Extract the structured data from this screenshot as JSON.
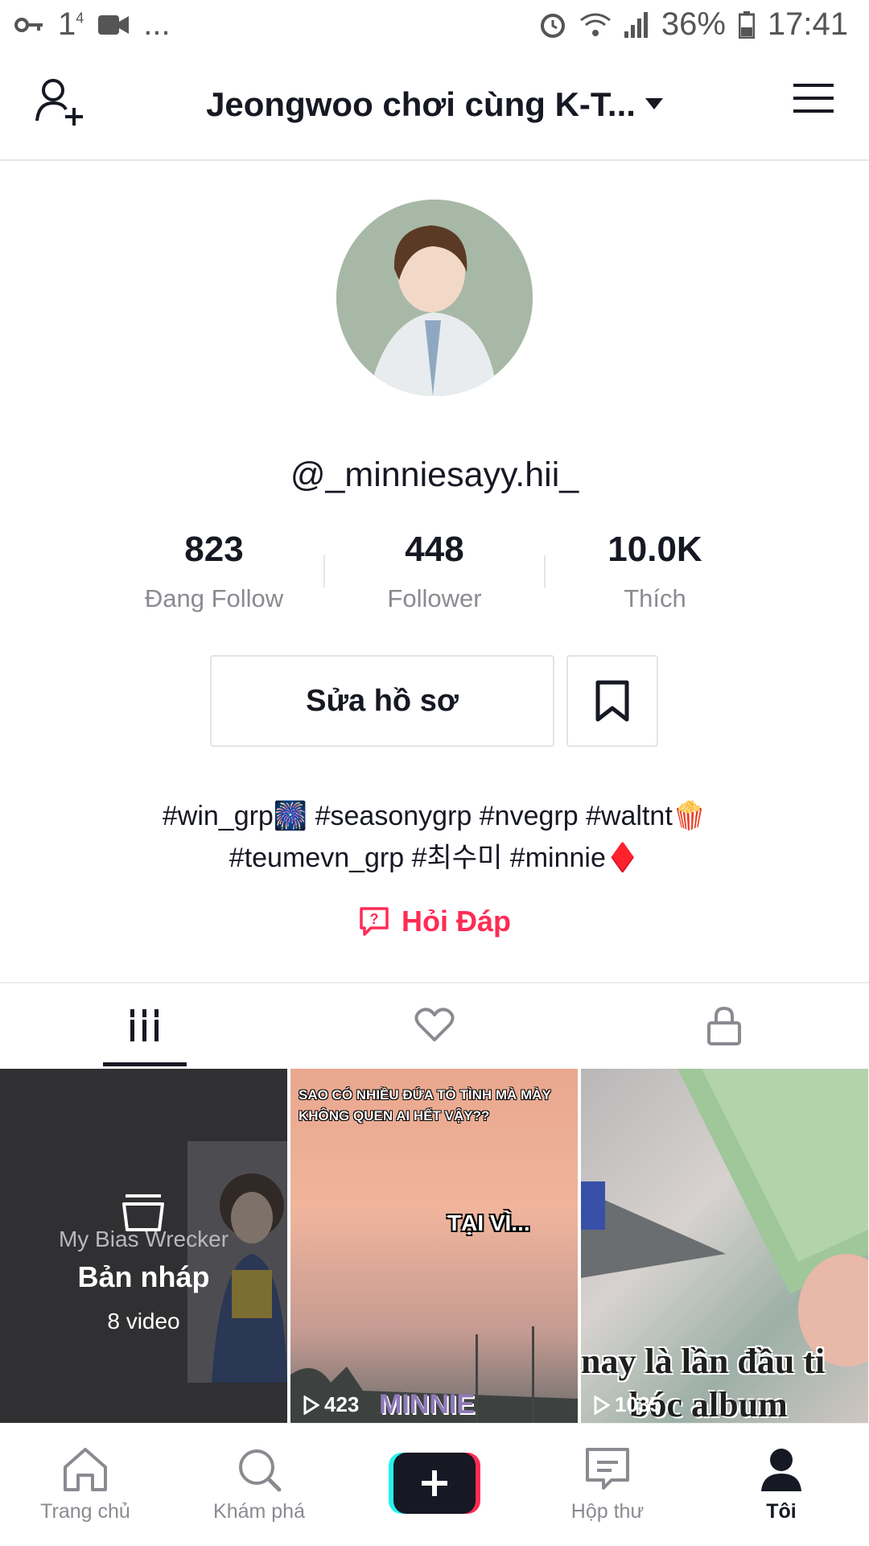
{
  "status_bar": {
    "left_text": "1",
    "left_superscript": "4",
    "more": "...",
    "battery": "36%",
    "time": "17:41"
  },
  "header": {
    "title": "Jeongwoo chơi cùng K-T..."
  },
  "profile": {
    "username": "@_minniesayy.hii_",
    "stats": [
      {
        "value": "823",
        "label": "Đang Follow"
      },
      {
        "value": "448",
        "label": "Follower"
      },
      {
        "value": "10.0K",
        "label": "Thích"
      }
    ],
    "edit_label": "Sửa hồ sơ",
    "bio_line1": "#win_grp🎆 #seasonygrp #nvegrp #waltnt🍿",
    "bio_line2": "#teumevn_grp #최수미 #minnie♦️",
    "qa_label": "Hỏi Đáp"
  },
  "grid": {
    "drafts_watermark": "My Bias Wrecker",
    "drafts_label": "Bản nháp",
    "drafts_count": "8 video",
    "video1_caption_top": "SAO CÓ NHIỀU ĐỨA TỎ TÌNH MÀ MÀY KHÔNG QUEN AI HẾT VẬY??",
    "video1_caption_mid": "TẠI VÌ...",
    "video1_views": "423",
    "video1_bottom": "MINNIE",
    "video2_caption": "nay là lần đầu ti",
    "video2_caption2": "bóc album",
    "video2_views": "1035"
  },
  "nav": {
    "home": "Trang chủ",
    "discover": "Khám phá",
    "inbox": "Hộp thư",
    "me": "Tôi"
  },
  "colors": {
    "accent": "#fe2c55",
    "text": "#161823",
    "muted": "#8a8b91"
  }
}
